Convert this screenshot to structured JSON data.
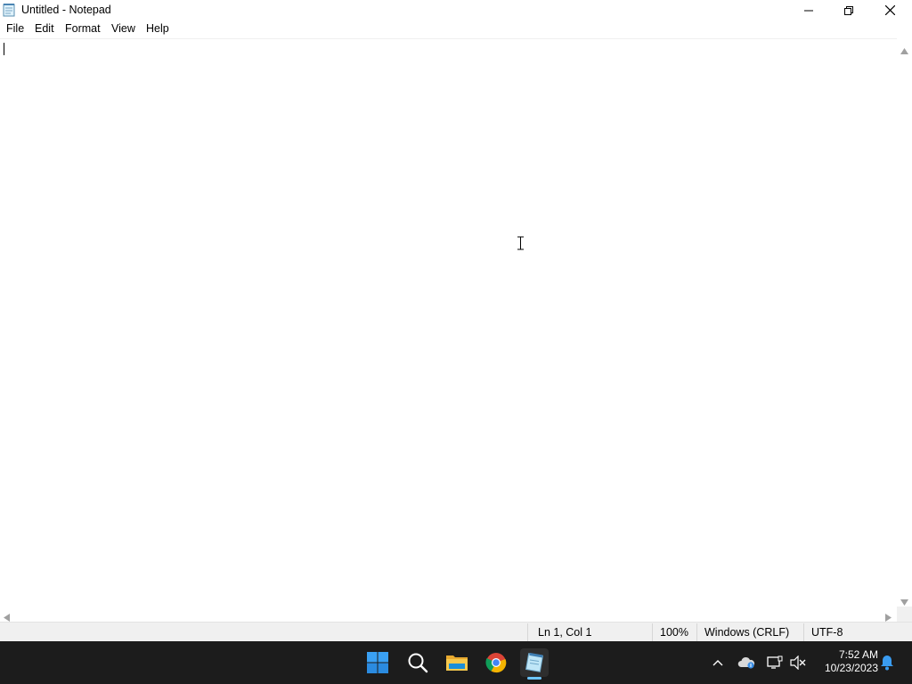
{
  "window": {
    "title": "Untitled - Notepad"
  },
  "menu": {
    "items": [
      {
        "label": "File"
      },
      {
        "label": "Edit"
      },
      {
        "label": "Format"
      },
      {
        "label": "View"
      },
      {
        "label": "Help"
      }
    ]
  },
  "editor": {
    "content": ""
  },
  "statusbar": {
    "position": "Ln 1, Col 1",
    "zoom": "100%",
    "line_ending": "Windows (CRLF)",
    "encoding": "UTF-8"
  },
  "taskbar": {
    "apps": [
      {
        "name": "start-icon"
      },
      {
        "name": "search-icon"
      },
      {
        "name": "file-explorer-icon"
      },
      {
        "name": "chrome-icon"
      },
      {
        "name": "notepad-icon",
        "active": true
      }
    ],
    "tray": {
      "time": "7:52 AM",
      "date": "10/23/2023"
    }
  },
  "colors": {
    "taskbar_bg": "#1c1c1c",
    "statusbar_bg": "#f0f0f0",
    "active_indicator": "#6cc5ff"
  }
}
